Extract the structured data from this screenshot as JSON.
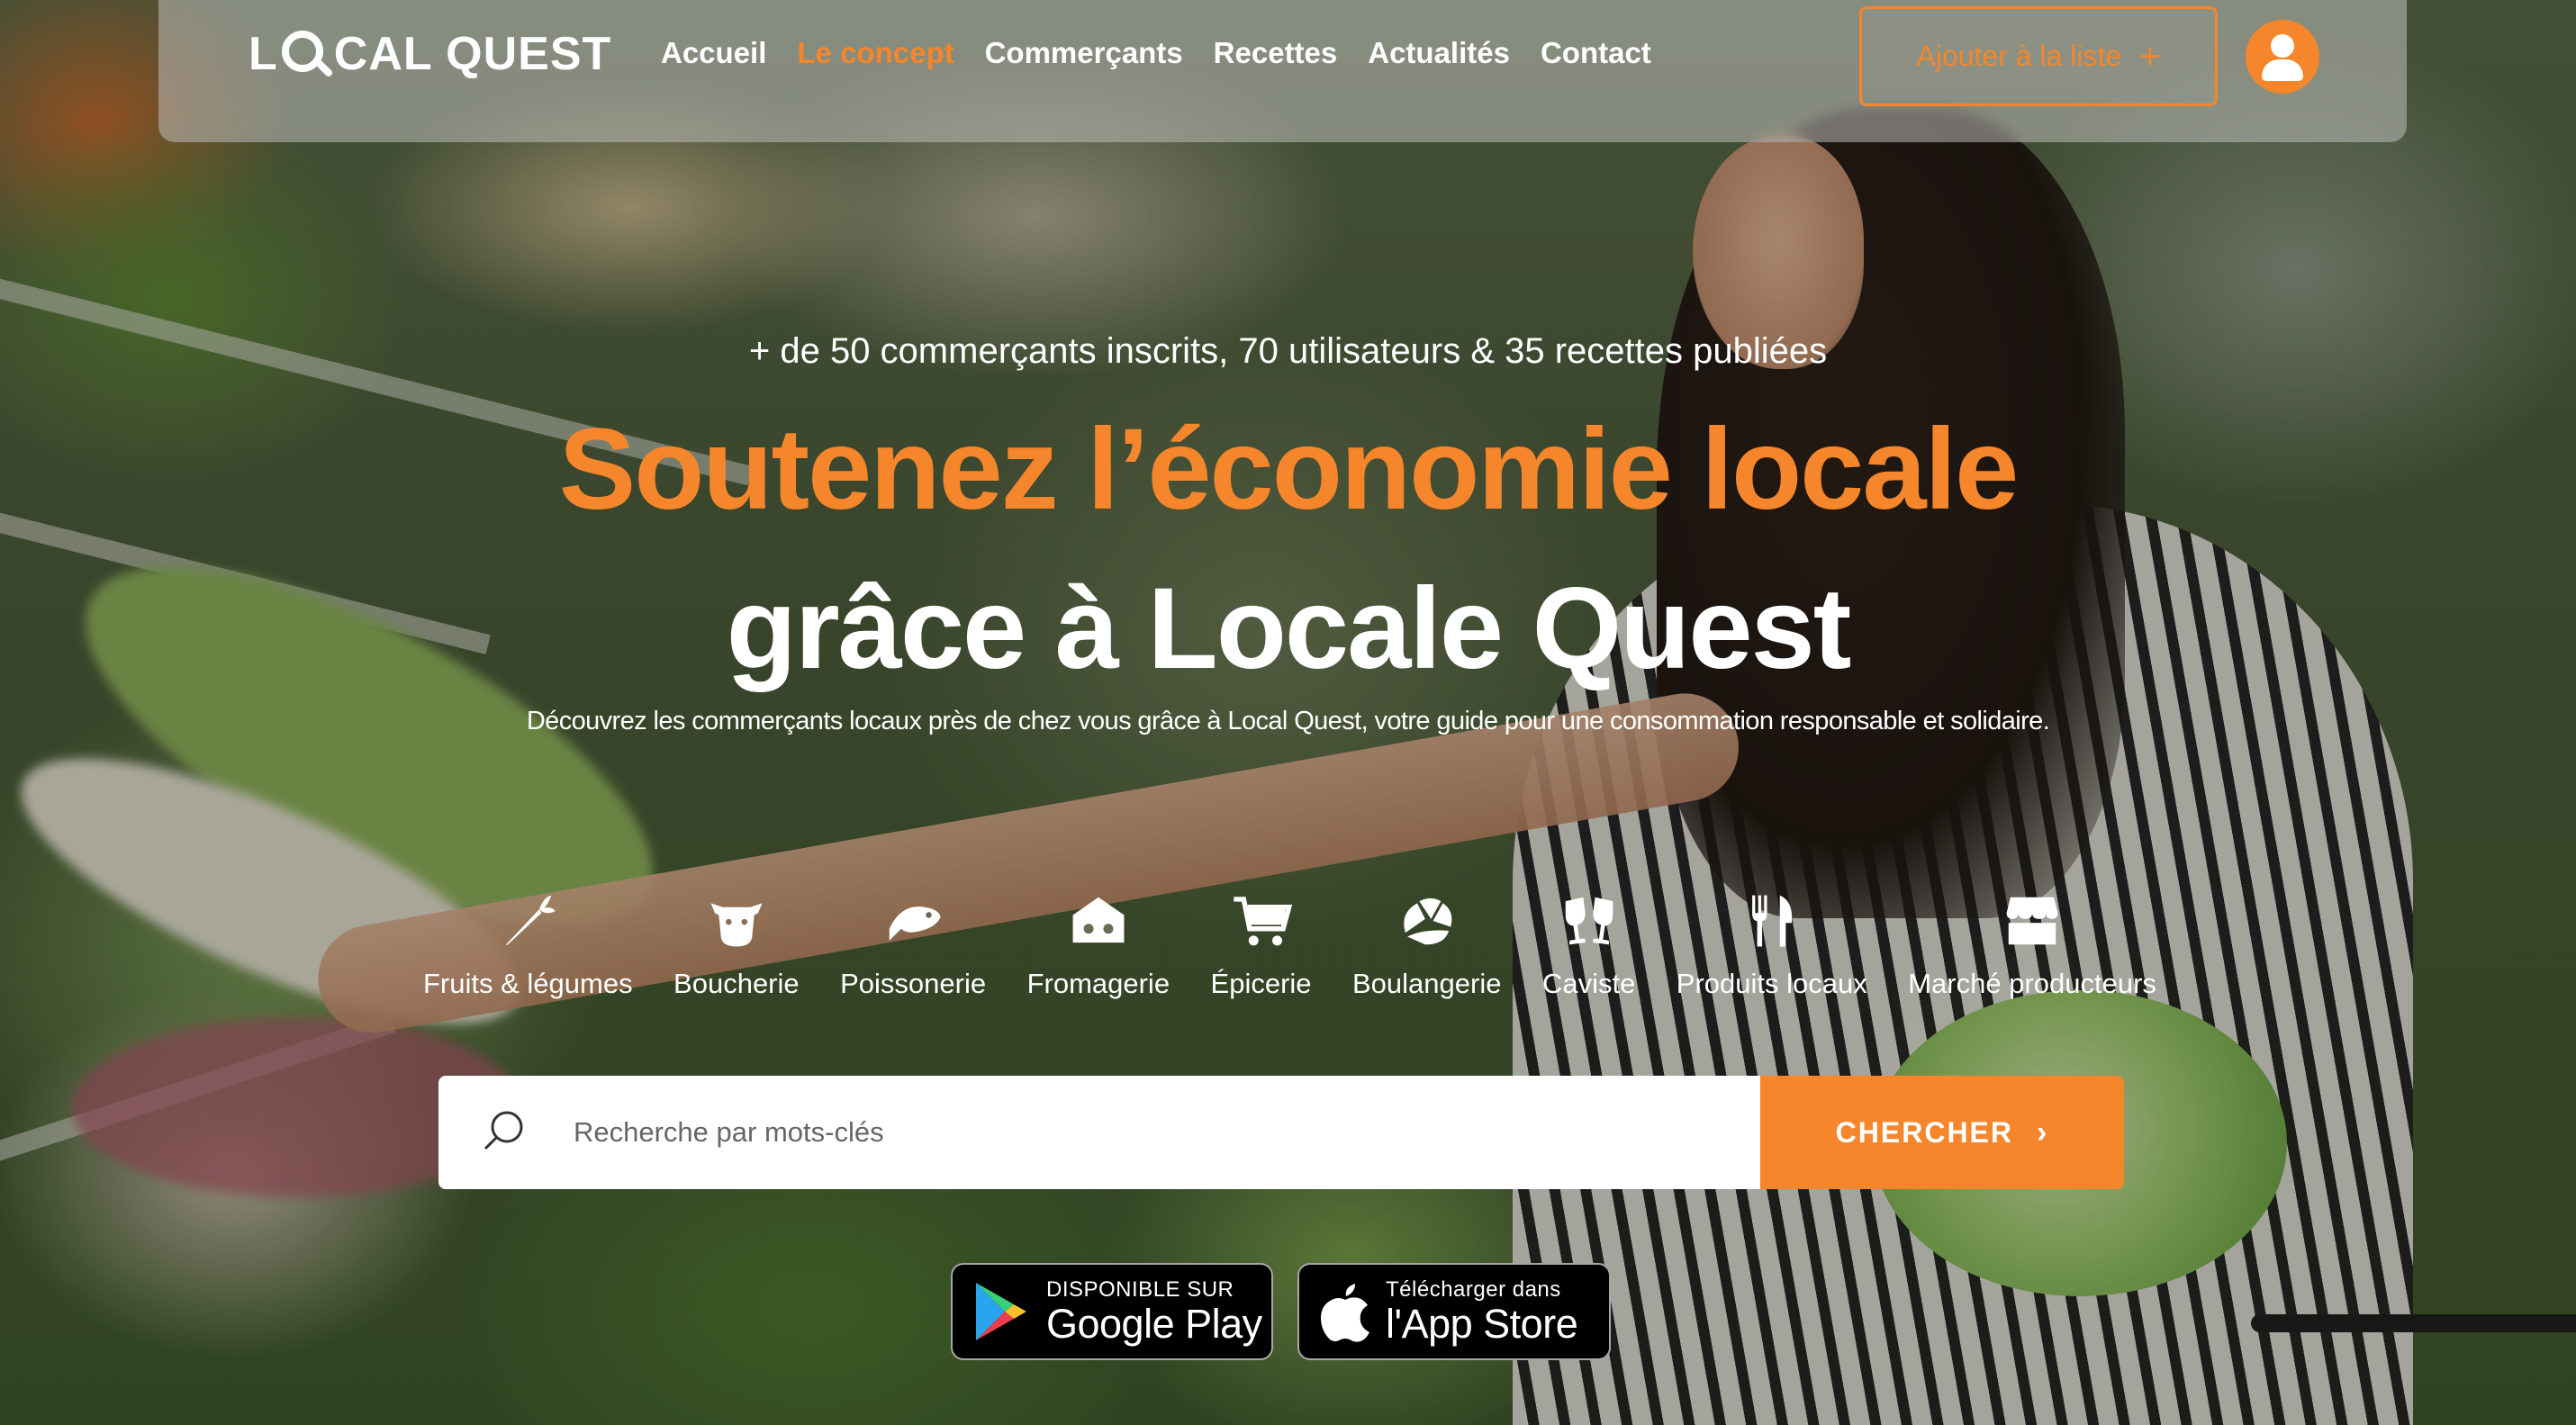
{
  "brand": {
    "logo_text_before": "L",
    "logo_text_after": "CAL QUEST"
  },
  "nav": {
    "items": [
      {
        "label": "Accueil",
        "active": false
      },
      {
        "label": "Le concept",
        "active": true
      },
      {
        "label": "Commerçants",
        "active": false
      },
      {
        "label": "Recettes",
        "active": false
      },
      {
        "label": "Actualités",
        "active": false
      },
      {
        "label": "Contact",
        "active": false
      }
    ],
    "add_button_label": "Ajouter à la liste",
    "add_button_icon": "plus-icon",
    "avatar_icon": "user-icon"
  },
  "hero": {
    "stats": "+ de 50 commerçants inscrits, 70 utilisateurs & 35 recettes publiées",
    "headline_line1": "Soutenez l’économie locale",
    "headline_line2": "grâce à Locale Quest",
    "description": "Découvrez les commerçants locaux près de chez vous grâce à Local Quest, votre guide pour une consommation responsable et solidaire."
  },
  "categories": [
    {
      "label": "Fruits & légumes",
      "icon": "carrot-icon"
    },
    {
      "label": "Boucherie",
      "icon": "cow-icon"
    },
    {
      "label": "Poissonerie",
      "icon": "fish-icon"
    },
    {
      "label": "Fromagerie",
      "icon": "cheese-icon"
    },
    {
      "label": "Épicerie",
      "icon": "cart-icon"
    },
    {
      "label": "Boulangerie",
      "icon": "croissant-icon"
    },
    {
      "label": "Caviste",
      "icon": "wine-glasses-icon"
    },
    {
      "label": "Produits locaux",
      "icon": "utensils-icon"
    },
    {
      "label": "Marché producteurs",
      "icon": "market-stall-icon"
    }
  ],
  "search": {
    "placeholder": "Recherche par mots-clés",
    "value": "",
    "button_label": "CHERCHER",
    "button_icon": "chevron-right-icon"
  },
  "stores": {
    "google_play": {
      "small": "DISPONIBLE SUR",
      "big": "Google Play"
    },
    "app_store": {
      "small": "Télécharger dans",
      "big": "l'App Store"
    }
  },
  "colors": {
    "accent": "#f5862b",
    "text_light": "#ffffff"
  }
}
